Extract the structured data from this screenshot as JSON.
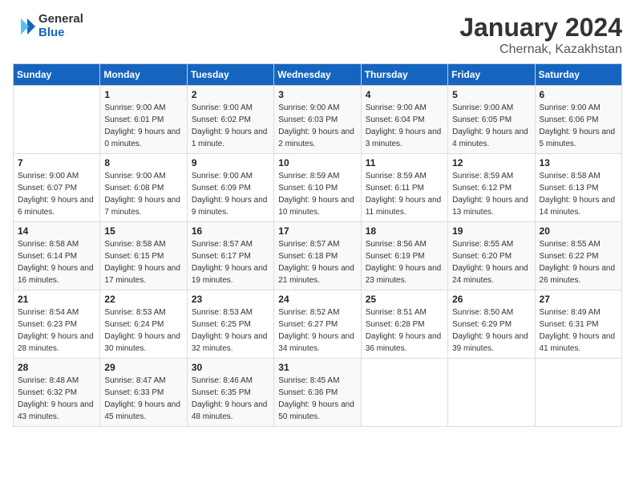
{
  "logo": {
    "general": "General",
    "blue": "Blue"
  },
  "header": {
    "title": "January 2024",
    "subtitle": "Chernak, Kazakhstan"
  },
  "days_of_week": [
    "Sunday",
    "Monday",
    "Tuesday",
    "Wednesday",
    "Thursday",
    "Friday",
    "Saturday"
  ],
  "weeks": [
    [
      {
        "day": "",
        "info": ""
      },
      {
        "day": "1",
        "sunrise": "Sunrise: 9:00 AM",
        "sunset": "Sunset: 6:01 PM",
        "daylight": "Daylight: 9 hours and 0 minutes."
      },
      {
        "day": "2",
        "sunrise": "Sunrise: 9:00 AM",
        "sunset": "Sunset: 6:02 PM",
        "daylight": "Daylight: 9 hours and 1 minute."
      },
      {
        "day": "3",
        "sunrise": "Sunrise: 9:00 AM",
        "sunset": "Sunset: 6:03 PM",
        "daylight": "Daylight: 9 hours and 2 minutes."
      },
      {
        "day": "4",
        "sunrise": "Sunrise: 9:00 AM",
        "sunset": "Sunset: 6:04 PM",
        "daylight": "Daylight: 9 hours and 3 minutes."
      },
      {
        "day": "5",
        "sunrise": "Sunrise: 9:00 AM",
        "sunset": "Sunset: 6:05 PM",
        "daylight": "Daylight: 9 hours and 4 minutes."
      },
      {
        "day": "6",
        "sunrise": "Sunrise: 9:00 AM",
        "sunset": "Sunset: 6:06 PM",
        "daylight": "Daylight: 9 hours and 5 minutes."
      }
    ],
    [
      {
        "day": "7",
        "sunrise": "Sunrise: 9:00 AM",
        "sunset": "Sunset: 6:07 PM",
        "daylight": "Daylight: 9 hours and 6 minutes."
      },
      {
        "day": "8",
        "sunrise": "Sunrise: 9:00 AM",
        "sunset": "Sunset: 6:08 PM",
        "daylight": "Daylight: 9 hours and 7 minutes."
      },
      {
        "day": "9",
        "sunrise": "Sunrise: 9:00 AM",
        "sunset": "Sunset: 6:09 PM",
        "daylight": "Daylight: 9 hours and 9 minutes."
      },
      {
        "day": "10",
        "sunrise": "Sunrise: 8:59 AM",
        "sunset": "Sunset: 6:10 PM",
        "daylight": "Daylight: 9 hours and 10 minutes."
      },
      {
        "day": "11",
        "sunrise": "Sunrise: 8:59 AM",
        "sunset": "Sunset: 6:11 PM",
        "daylight": "Daylight: 9 hours and 11 minutes."
      },
      {
        "day": "12",
        "sunrise": "Sunrise: 8:59 AM",
        "sunset": "Sunset: 6:12 PM",
        "daylight": "Daylight: 9 hours and 13 minutes."
      },
      {
        "day": "13",
        "sunrise": "Sunrise: 8:58 AM",
        "sunset": "Sunset: 6:13 PM",
        "daylight": "Daylight: 9 hours and 14 minutes."
      }
    ],
    [
      {
        "day": "14",
        "sunrise": "Sunrise: 8:58 AM",
        "sunset": "Sunset: 6:14 PM",
        "daylight": "Daylight: 9 hours and 16 minutes."
      },
      {
        "day": "15",
        "sunrise": "Sunrise: 8:58 AM",
        "sunset": "Sunset: 6:15 PM",
        "daylight": "Daylight: 9 hours and 17 minutes."
      },
      {
        "day": "16",
        "sunrise": "Sunrise: 8:57 AM",
        "sunset": "Sunset: 6:17 PM",
        "daylight": "Daylight: 9 hours and 19 minutes."
      },
      {
        "day": "17",
        "sunrise": "Sunrise: 8:57 AM",
        "sunset": "Sunset: 6:18 PM",
        "daylight": "Daylight: 9 hours and 21 minutes."
      },
      {
        "day": "18",
        "sunrise": "Sunrise: 8:56 AM",
        "sunset": "Sunset: 6:19 PM",
        "daylight": "Daylight: 9 hours and 23 minutes."
      },
      {
        "day": "19",
        "sunrise": "Sunrise: 8:55 AM",
        "sunset": "Sunset: 6:20 PM",
        "daylight": "Daylight: 9 hours and 24 minutes."
      },
      {
        "day": "20",
        "sunrise": "Sunrise: 8:55 AM",
        "sunset": "Sunset: 6:22 PM",
        "daylight": "Daylight: 9 hours and 26 minutes."
      }
    ],
    [
      {
        "day": "21",
        "sunrise": "Sunrise: 8:54 AM",
        "sunset": "Sunset: 6:23 PM",
        "daylight": "Daylight: 9 hours and 28 minutes."
      },
      {
        "day": "22",
        "sunrise": "Sunrise: 8:53 AM",
        "sunset": "Sunset: 6:24 PM",
        "daylight": "Daylight: 9 hours and 30 minutes."
      },
      {
        "day": "23",
        "sunrise": "Sunrise: 8:53 AM",
        "sunset": "Sunset: 6:25 PM",
        "daylight": "Daylight: 9 hours and 32 minutes."
      },
      {
        "day": "24",
        "sunrise": "Sunrise: 8:52 AM",
        "sunset": "Sunset: 6:27 PM",
        "daylight": "Daylight: 9 hours and 34 minutes."
      },
      {
        "day": "25",
        "sunrise": "Sunrise: 8:51 AM",
        "sunset": "Sunset: 6:28 PM",
        "daylight": "Daylight: 9 hours and 36 minutes."
      },
      {
        "day": "26",
        "sunrise": "Sunrise: 8:50 AM",
        "sunset": "Sunset: 6:29 PM",
        "daylight": "Daylight: 9 hours and 39 minutes."
      },
      {
        "day": "27",
        "sunrise": "Sunrise: 8:49 AM",
        "sunset": "Sunset: 6:31 PM",
        "daylight": "Daylight: 9 hours and 41 minutes."
      }
    ],
    [
      {
        "day": "28",
        "sunrise": "Sunrise: 8:48 AM",
        "sunset": "Sunset: 6:32 PM",
        "daylight": "Daylight: 9 hours and 43 minutes."
      },
      {
        "day": "29",
        "sunrise": "Sunrise: 8:47 AM",
        "sunset": "Sunset: 6:33 PM",
        "daylight": "Daylight: 9 hours and 45 minutes."
      },
      {
        "day": "30",
        "sunrise": "Sunrise: 8:46 AM",
        "sunset": "Sunset: 6:35 PM",
        "daylight": "Daylight: 9 hours and 48 minutes."
      },
      {
        "day": "31",
        "sunrise": "Sunrise: 8:45 AM",
        "sunset": "Sunset: 6:36 PM",
        "daylight": "Daylight: 9 hours and 50 minutes."
      },
      {
        "day": "",
        "info": ""
      },
      {
        "day": "",
        "info": ""
      },
      {
        "day": "",
        "info": ""
      }
    ]
  ]
}
